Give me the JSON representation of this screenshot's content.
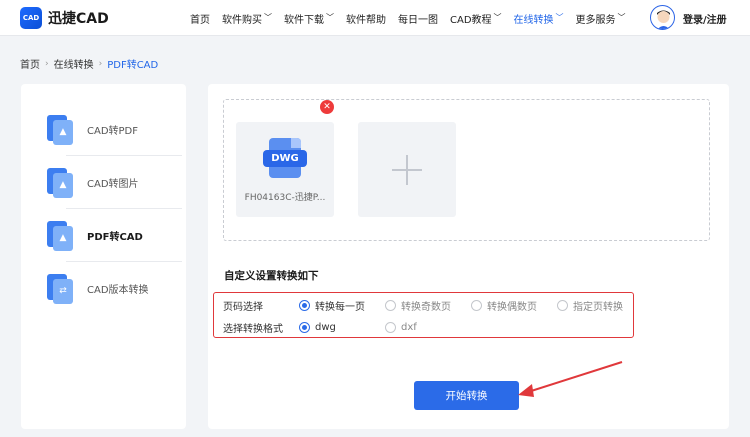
{
  "header": {
    "logo_mark": "CAD",
    "logo_text": "迅捷CAD",
    "nav": [
      {
        "label": "首页",
        "has_menu": false,
        "active": false
      },
      {
        "label": "软件购买",
        "has_menu": true,
        "active": false
      },
      {
        "label": "软件下载",
        "has_menu": true,
        "active": false
      },
      {
        "label": "软件帮助",
        "has_menu": false,
        "active": false
      },
      {
        "label": "每日一图",
        "has_menu": false,
        "active": false
      },
      {
        "label": "CAD教程",
        "has_menu": true,
        "active": false
      },
      {
        "label": "在线转换",
        "has_menu": true,
        "active": true
      },
      {
        "label": "更多服务",
        "has_menu": true,
        "active": false
      }
    ],
    "login_label": "登录/注册"
  },
  "breadcrumb": {
    "home": "首页",
    "section": "在线转换",
    "current": "PDF转CAD"
  },
  "sidebar": {
    "items": [
      {
        "label": "CAD转PDF",
        "active": false
      },
      {
        "label": "CAD转图片",
        "active": false
      },
      {
        "label": "PDF转CAD",
        "active": true
      },
      {
        "label": "CAD版本转换",
        "active": false
      }
    ]
  },
  "upload": {
    "file_badge": "DWG",
    "file_name": "FH04163C-迅捷P...",
    "remove_glyph": "✕"
  },
  "settings": {
    "title": "自定义设置转换如下",
    "page_label": "页码选择",
    "page_options": [
      {
        "label": "转换每一页",
        "checked": true
      },
      {
        "label": "转换奇数页",
        "checked": false
      },
      {
        "label": "转换偶数页",
        "checked": false
      },
      {
        "label": "指定页转换",
        "checked": false
      }
    ],
    "format_label": "选择转换格式",
    "format_options": [
      {
        "label": "dwg",
        "checked": true
      },
      {
        "label": "dxf",
        "checked": false
      }
    ]
  },
  "start_button": "开始转换",
  "colors": {
    "accent": "#2b6be8",
    "highlight": "#e0383b",
    "remove": "#ee3b3b"
  }
}
